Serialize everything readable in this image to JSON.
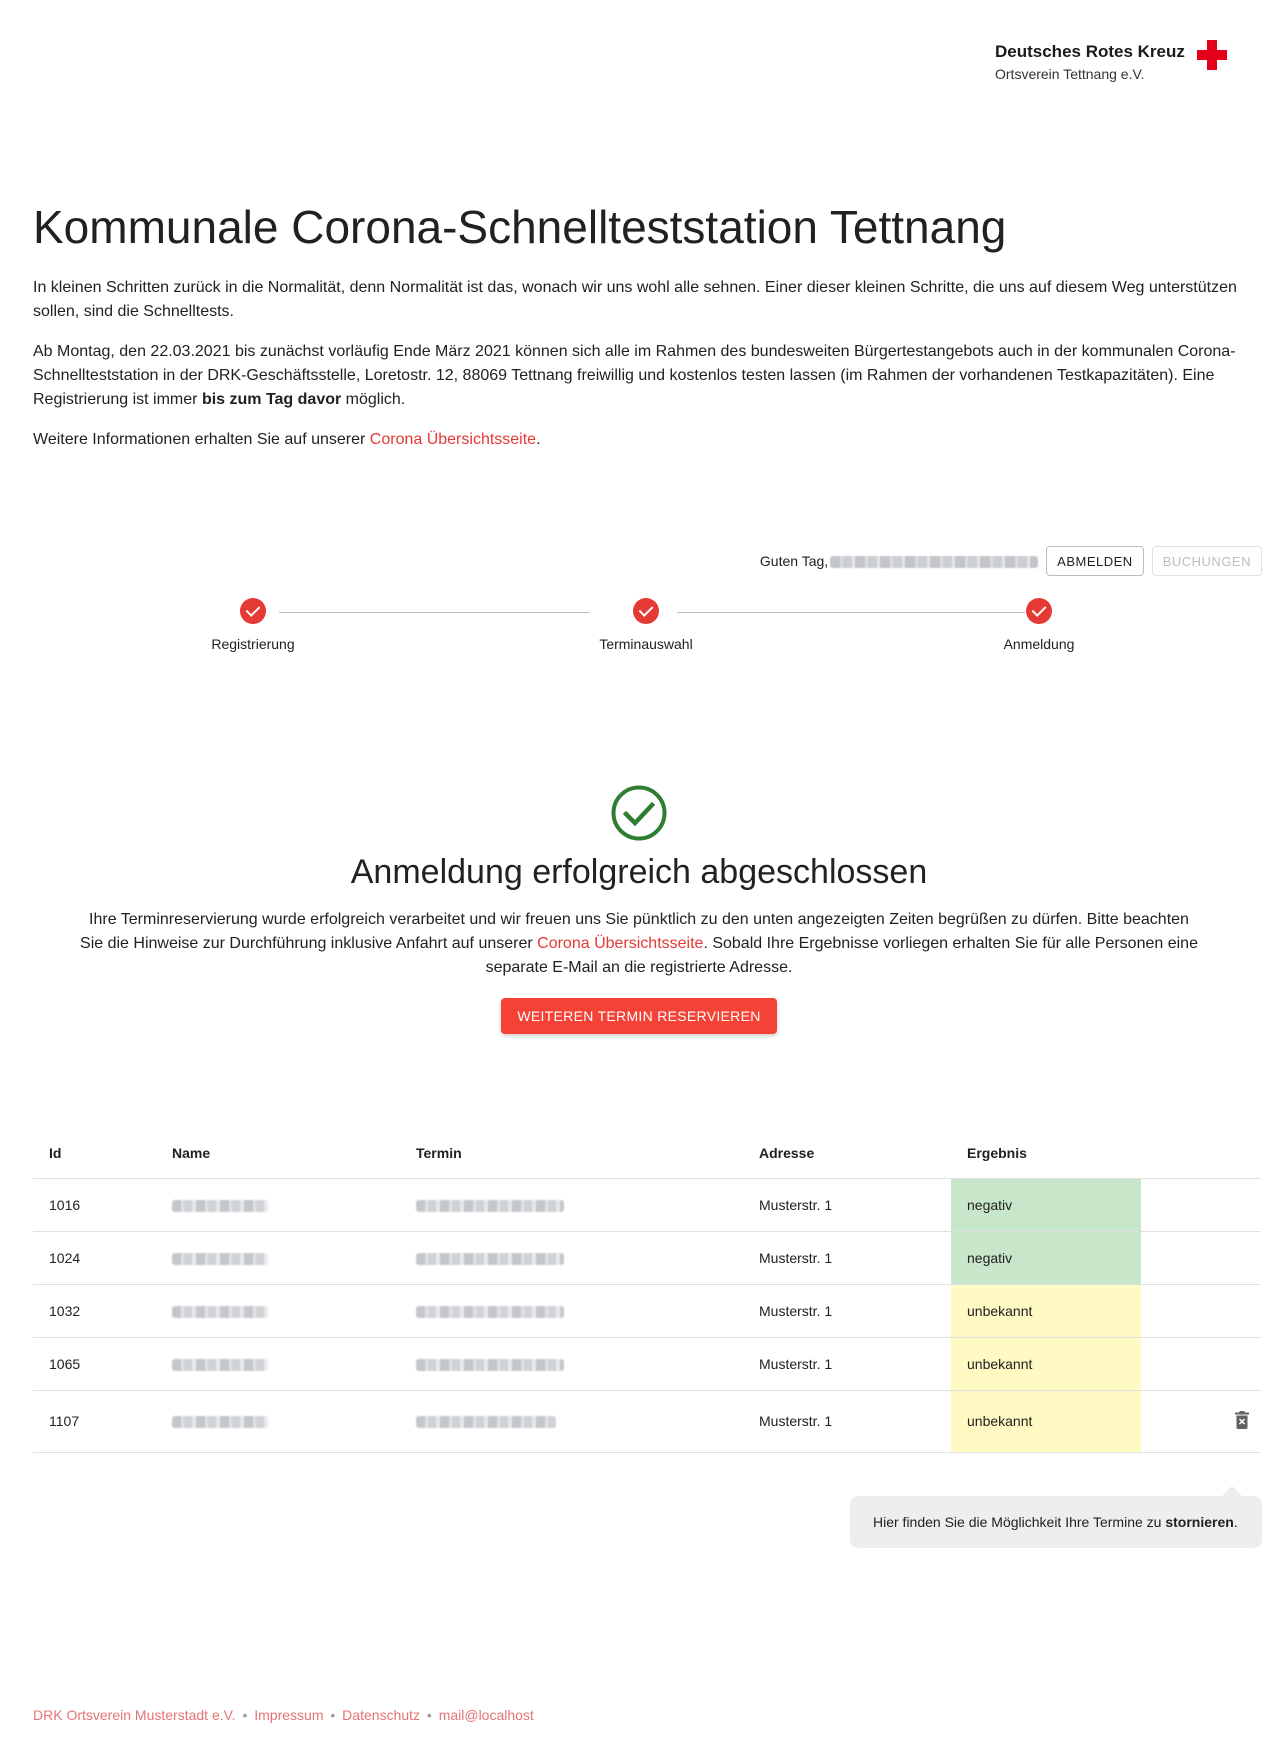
{
  "logo": {
    "title": "Deutsches Rotes Kreuz",
    "subtitle": "Ortsverein Tettnang e.V."
  },
  "intro": {
    "title": "Kommunale Corona-Schnellteststation Tettnang",
    "p1": "In kleinen Schritten zurück in die Normalität, denn Normalität ist das, wonach wir uns wohl alle sehnen. Einer dieser kleinen Schritte, die uns auf diesem Weg unterstützen sollen, sind die Schnelltests.",
    "p2_before": "Ab Montag, den 22.03.2021 bis zunächst vorläufig Ende März 2021 können sich alle im Rahmen des bundesweiten Bürgertestangebots auch in der kommunalen Corona-Schnellteststation in der DRK-Geschäftsstelle, Loretostr. 12, 88069 Tettnang freiwillig und kostenlos testen lassen (im Rahmen der vorhandenen Testkapazitäten). Eine Registrierung ist immer ",
    "p2_bold": "bis zum Tag davor",
    "p2_after": " möglich.",
    "p3_before": "Weitere Informationen erhalten Sie auf unserer ",
    "p3_link": "Corona Übersichtsseite",
    "p3_after": "."
  },
  "userbar": {
    "greeting": "Guten Tag,",
    "logout_label": "ABMELDEN",
    "bookings_label": "BUCHUNGEN"
  },
  "stepper": {
    "steps": [
      {
        "label": "Registrierung"
      },
      {
        "label": "Terminauswahl"
      },
      {
        "label": "Anmeldung"
      }
    ]
  },
  "success": {
    "title": "Anmeldung erfolgreich abgeschlossen",
    "text_before": "Ihre Terminreservierung wurde erfolgreich verarbeitet und wir freuen uns Sie pünktlich zu den unten angezeigten Zeiten begrüßen zu dürfen. Bitte beachten Sie die Hinweise zur Durchführung inklusive Anfahrt auf unserer ",
    "text_link": "Corona Übersichtsseite",
    "text_after": ". Sobald Ihre Ergebnisse vorliegen erhalten Sie für alle Personen eine separate E-Mail an die registrierte Adresse.",
    "button_label": "WEITEREN TERMIN RESERVIEREN"
  },
  "table": {
    "headers": {
      "id": "Id",
      "name": "Name",
      "termin": "Termin",
      "adresse": "Adresse",
      "ergebnis": "Ergebnis"
    },
    "rows": [
      {
        "id": "1016",
        "adresse": "Musterstr. 1",
        "ergebnis": "negativ"
      },
      {
        "id": "1024",
        "adresse": "Musterstr. 1",
        "ergebnis": "negativ"
      },
      {
        "id": "1032",
        "adresse": "Musterstr. 1",
        "ergebnis": "unbekannt"
      },
      {
        "id": "1065",
        "adresse": "Musterstr. 1",
        "ergebnis": "unbekannt"
      },
      {
        "id": "1107",
        "adresse": "Musterstr. 1",
        "ergebnis": "unbekannt"
      }
    ]
  },
  "tooltip": {
    "text_before": "Hier finden Sie die Möglichkeit Ihre Termine zu ",
    "text_bold": "stornieren",
    "text_after": "."
  },
  "footer": {
    "org": "DRK Ortsverein Musterstadt e.V.",
    "separator": "•",
    "impressum": "Impressum",
    "datenschutz": "Datenschutz",
    "mail": "mail@localhost"
  },
  "colors": {
    "accent": "#f44336",
    "negativ": "#c8e6c9",
    "unbekannt": "#fff9c4",
    "success_check": "#2e7d32"
  }
}
